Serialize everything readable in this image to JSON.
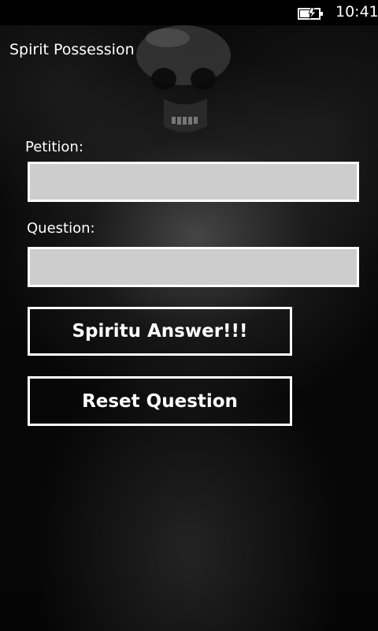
{
  "status_bar": {
    "time": "10:41",
    "battery_icon": "battery-charging-icon"
  },
  "app": {
    "title": "Spirit Possession"
  },
  "form": {
    "petition_label": "Petition:",
    "petition_value": "",
    "question_label": "Question:",
    "question_value": ""
  },
  "buttons": {
    "answer_label": "Spiritu Answer!!!",
    "reset_label": "Reset Question"
  },
  "colors": {
    "field_background": "#cdcdcd",
    "border": "#ffffff",
    "text": "#ffffff",
    "background": "#000000"
  }
}
